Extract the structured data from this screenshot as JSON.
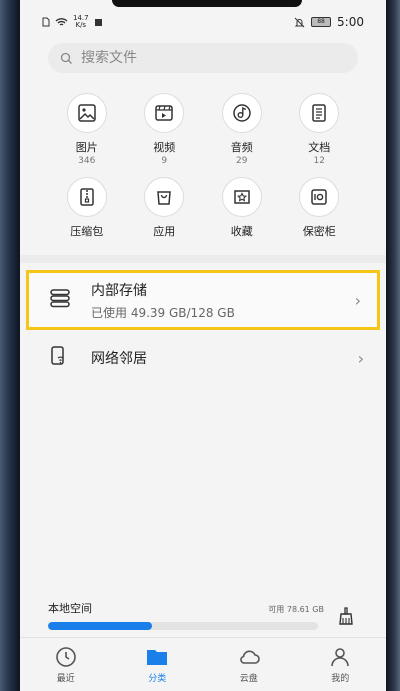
{
  "status_bar": {
    "net_speed_value": "14.7",
    "net_speed_unit": "K/s",
    "battery": "88",
    "time": "5:00"
  },
  "search": {
    "placeholder": "搜索文件"
  },
  "categories": [
    {
      "label": "图片",
      "count": "346",
      "icon": "image-icon"
    },
    {
      "label": "视频",
      "count": "9",
      "icon": "video-icon"
    },
    {
      "label": "音频",
      "count": "29",
      "icon": "audio-icon"
    },
    {
      "label": "文档",
      "count": "12",
      "icon": "document-icon"
    },
    {
      "label": "压缩包",
      "count": "",
      "icon": "archive-icon"
    },
    {
      "label": "应用",
      "count": "",
      "icon": "app-bag-icon"
    },
    {
      "label": "收藏",
      "count": "",
      "icon": "favorite-icon"
    },
    {
      "label": "保密柜",
      "count": "",
      "icon": "safe-icon"
    }
  ],
  "storage": {
    "internal_title": "内部存储",
    "internal_usage": "已使用 49.39 GB/128 GB",
    "network_title": "网络邻居"
  },
  "local_space": {
    "label": "本地空间",
    "available": "可用 78.61 GB",
    "used_fraction": 0.386
  },
  "bottom_nav": [
    {
      "label": "最近",
      "icon": "clock-icon",
      "active": false
    },
    {
      "label": "分类",
      "icon": "folder-icon",
      "active": true
    },
    {
      "label": "云盘",
      "icon": "cloud-icon",
      "active": false
    },
    {
      "label": "我的",
      "icon": "person-icon",
      "active": false
    }
  ],
  "colors": {
    "accent": "#1a7fe8",
    "highlight": "#f5c518"
  }
}
